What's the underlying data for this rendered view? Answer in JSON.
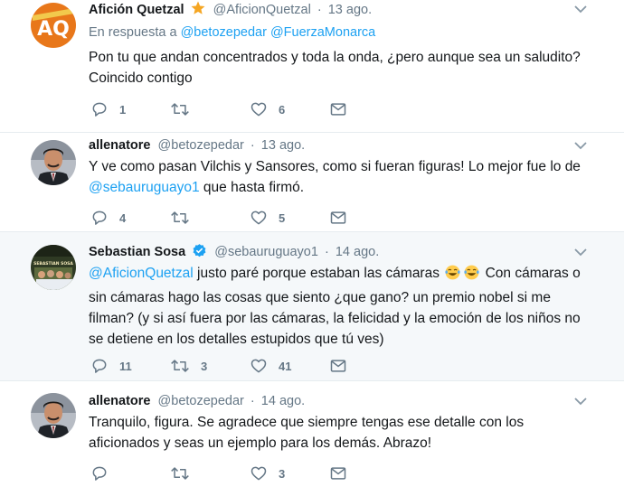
{
  "tweets": [
    {
      "name": "Afición Quetzal",
      "handle": "@AficionQuetzal",
      "sep": "·",
      "time": "13 ago.",
      "reply_label": "En respuesta a",
      "reply_users": [
        "@betozepedar",
        "@FuerzaMonarca"
      ],
      "text": "Pon tu que andan concentrados y toda la onda, ¿pero aunque sea un saludito? Coincido contigo",
      "avatar_text": "AQ",
      "counts": {
        "reply": "1",
        "retweet": "",
        "like": "6"
      }
    },
    {
      "name": "allenatore",
      "handle": "@betozepedar",
      "sep": "·",
      "time": "13 ago.",
      "text_a": "Y ve como pasan Vilchis y Sansores, como si fueran figuras! Lo mejor fue lo de",
      "mention": "@sebauruguayo1",
      "text_b": "que hasta firmó.",
      "counts": {
        "reply": "4",
        "retweet": "",
        "like": "5"
      }
    },
    {
      "name": "Sebastian Sosa",
      "handle": "@sebauruguayo1",
      "sep": "·",
      "time": "14 ago.",
      "mention": "@AficionQuetzal",
      "text_a": "justo paré porque estaban las cámaras",
      "text_b": "Con cámaras o sin cámaras hago las cosas que siento ¿que gano? un premio nobel si me filman? (y si así fuera por las cámaras, la felicidad y la emoción de los niños no se detiene en los detalles estupidos que tú ves)",
      "avatar_text": "SEBASTIAN SOSA",
      "counts": {
        "reply": "11",
        "retweet": "3",
        "like": "41"
      }
    },
    {
      "name": "allenatore",
      "handle": "@betozepedar",
      "sep": "·",
      "time": "14 ago.",
      "text": "Tranquilo, figura. Se agradece que siempre tengas ese detalle con los aficionados y seas un ejemplo para los demás. Abrazo!",
      "counts": {
        "reply": "",
        "retweet": "",
        "like": "3"
      }
    }
  ],
  "icons": {
    "reply": "reply-icon",
    "retweet": "retweet-icon",
    "like": "heart-icon",
    "dm": "envelope-icon",
    "caret": "chevron-down-icon",
    "verified": "verified-badge-icon",
    "star": "star-icon",
    "emoji": "tears-of-joy-emoji"
  },
  "colors": {
    "link": "#1da1f2",
    "secondary": "#657786",
    "thread": "#c4dbe8",
    "highlight_bg": "#f5f8fa",
    "star": "#f5a623",
    "avatar_aq": "#e8771a"
  }
}
